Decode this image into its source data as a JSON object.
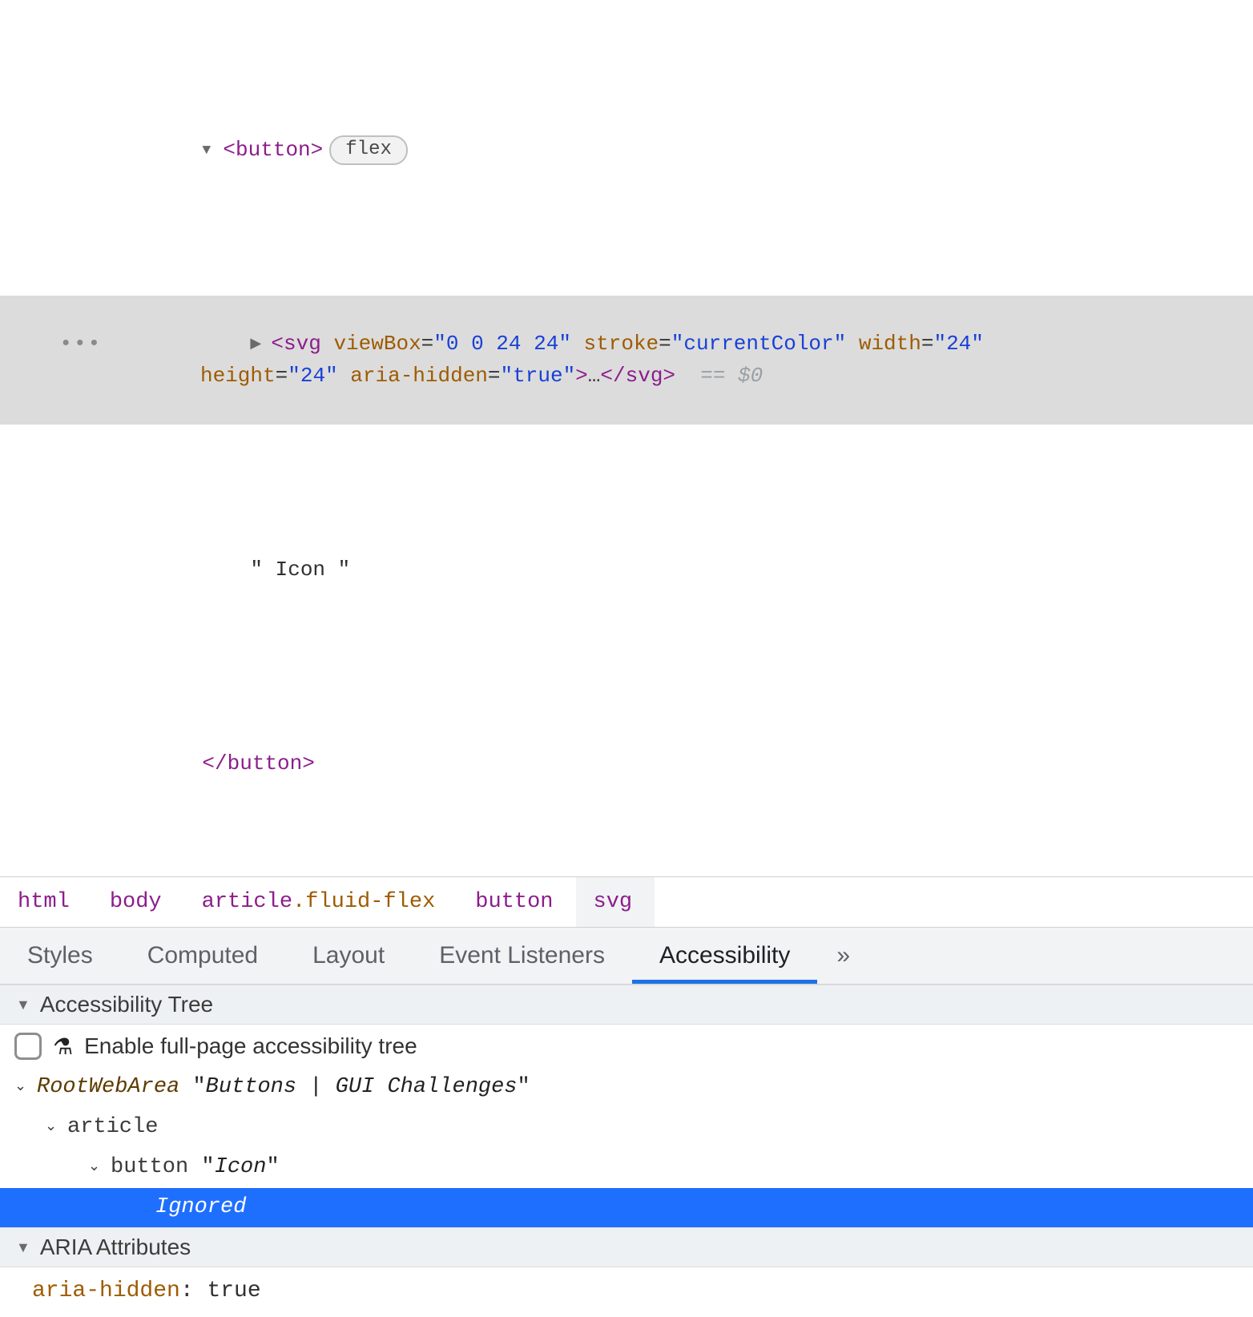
{
  "elements": {
    "button_open_tag": "button",
    "flex_pill": "flex",
    "svg_tag": "svg",
    "svg_attrs": {
      "viewBox_name": "viewBox",
      "viewBox_val": "0 0 24 24",
      "stroke_name": "stroke",
      "stroke_val": "currentColor",
      "width_name": "width",
      "width_val": "24",
      "height_name": "height",
      "height_val": "24",
      "aria_hidden_name": "aria-hidden",
      "aria_hidden_val": "true"
    },
    "collapsed_ellipsis": "…",
    "eq_dollar": "== $0",
    "text_node": "\" Icon \"",
    "button_close_tag": "button"
  },
  "breadcrumbs": [
    {
      "label": "html"
    },
    {
      "label": "body"
    },
    {
      "label": "article",
      "cls": ".fluid-flex"
    },
    {
      "label": "button"
    },
    {
      "label": "svg",
      "selected": true
    }
  ],
  "pane_tabs": {
    "styles": "Styles",
    "computed": "Computed",
    "layout": "Layout",
    "event_listeners": "Event Listeners",
    "accessibility": "Accessibility",
    "more": "»"
  },
  "a11y": {
    "tree_header": "Accessibility Tree",
    "enable_full_tree": "Enable full-page accessibility tree",
    "tree": {
      "root_role": "RootWebArea",
      "root_name": "Buttons | GUI Challenges",
      "article_role": "article",
      "button_role": "button",
      "button_name": "Icon",
      "ignored": "Ignored"
    },
    "aria_header": "ARIA Attributes",
    "aria_attr_name": "aria-hidden",
    "aria_attr_val": "true"
  }
}
